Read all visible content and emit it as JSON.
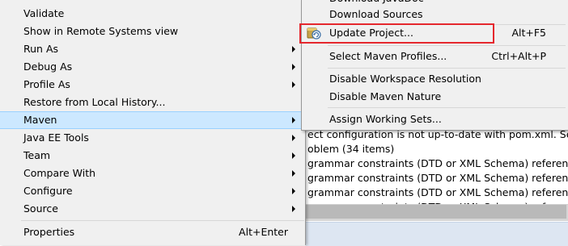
{
  "background_view": {
    "rows": [
      "ect configuration is not up-to-date with pom.xml. Select",
      "oblem (34 items)",
      "grammar constraints (DTD or XML Schema) referenced",
      "grammar constraints (DTD or XML Schema) referenced",
      "grammar constraints (DTD or XML Schema) referenced",
      "grammar constraints (DTD or XML Schema) referenced"
    ]
  },
  "context_menu": {
    "items": [
      {
        "label": "Validate"
      },
      {
        "label": "Show in Remote Systems view"
      },
      {
        "label": "Run As",
        "submenu": true
      },
      {
        "label": "Debug As",
        "submenu": true
      },
      {
        "label": "Profile As",
        "submenu": true
      },
      {
        "label": "Restore from Local History..."
      },
      {
        "label": "Maven",
        "submenu": true,
        "selected": true
      },
      {
        "label": "Java EE Tools",
        "submenu": true
      },
      {
        "label": "Team",
        "submenu": true
      },
      {
        "label": "Compare With",
        "submenu": true
      },
      {
        "label": "Configure",
        "submenu": true
      },
      {
        "label": "Source",
        "submenu": true
      },
      {
        "label": "Properties",
        "accelerator": "Alt+Enter"
      }
    ]
  },
  "maven_submenu": {
    "cut_item": "Download JavaDoc",
    "items": [
      {
        "label": "Download Sources"
      },
      {
        "label": "Update Project...",
        "accelerator": "Alt+F5",
        "icon": "maven-update-icon",
        "highlighted": true
      },
      {
        "label": "Select Maven Profiles...",
        "accelerator": "Ctrl+Alt+P"
      },
      {
        "label": "Disable Workspace Resolution"
      },
      {
        "label": "Disable Maven Nature"
      },
      {
        "label": "Assign Working Sets..."
      }
    ]
  },
  "colors": {
    "menu_bg": "#f0f0f0",
    "selection": "#cce8ff",
    "highlight_box": "#e5272d"
  }
}
